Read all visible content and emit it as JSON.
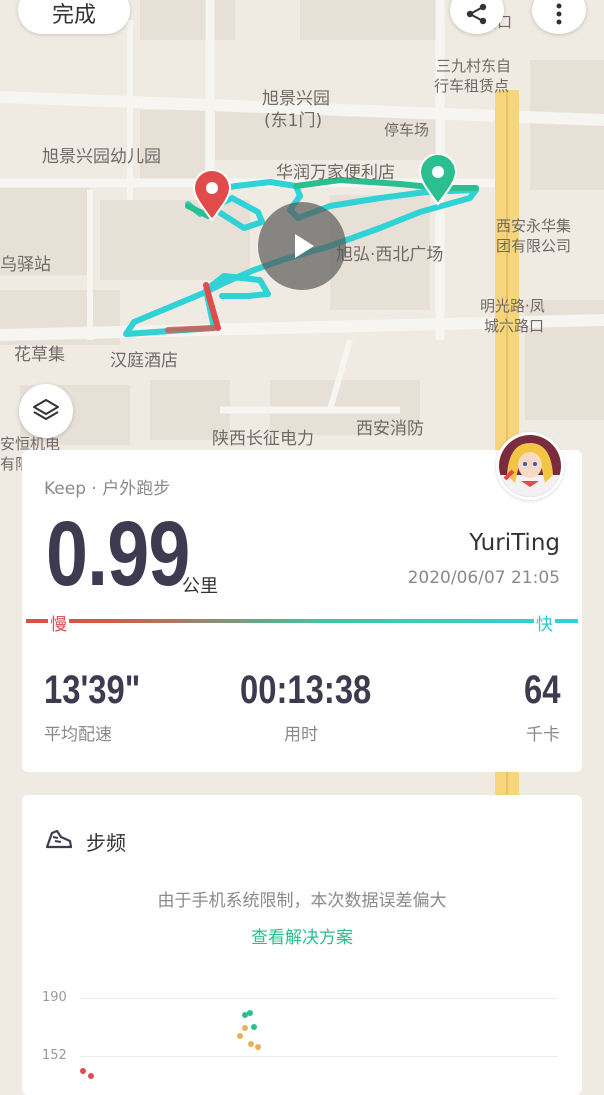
{
  "header": {
    "done_label": "完成"
  },
  "map": {
    "labels": {
      "l1": "旭景兴园",
      "l2": "(东1门)",
      "l3": "旭景兴园幼儿园",
      "l4": "华润万家便利店",
      "l5": "停车场",
      "l6": "三九村东自",
      "l7": "行车租赁点",
      "l8": "西安永华集",
      "l9": "团有限公司",
      "l10": "旭弘·西北广场",
      "l11": "乌驿站",
      "l12": "明光路·凤",
      "l13": "城六路口",
      "l14": "花草集",
      "l15": "汉庭酒店",
      "l16": "陕西长征电力",
      "l17": "西安消防",
      "l18": "安恒机电",
      "l19": "有限",
      "l20": "路口"
    }
  },
  "summary": {
    "source": "Keep · 户外跑步",
    "distance": "0.99",
    "distance_unit": "公里",
    "user": "YuriTing",
    "datetime": "2020/06/07 21:05",
    "slow_label": "慢",
    "fast_label": "快",
    "pace": "13'39\"",
    "pace_label": "平均配速",
    "duration": "00:13:38",
    "duration_label": "用时",
    "calories": "64",
    "calories_label": "千卡"
  },
  "cadence": {
    "title": "步频",
    "note": "由于手机系统限制，本次数据误差偏大",
    "link": "查看解决方案",
    "y_ticks": [
      "190",
      "152"
    ]
  },
  "colors": {
    "accent": "#2bbf8f",
    "slow": "#e24b4b",
    "fast": "#2fd3d6"
  }
}
